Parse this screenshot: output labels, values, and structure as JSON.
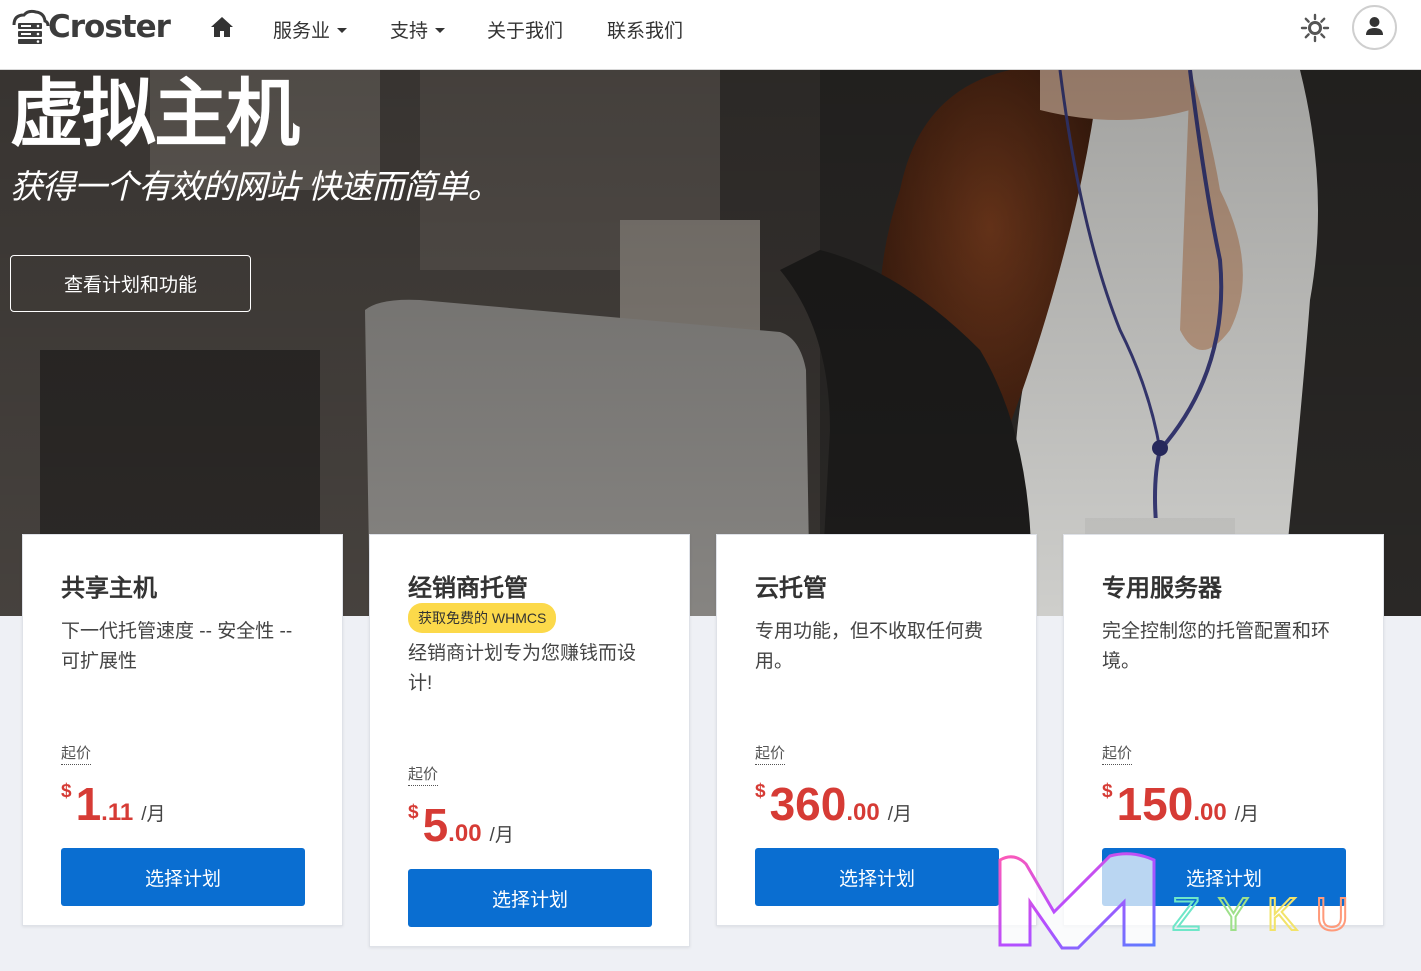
{
  "nav": {
    "brand": "Croster",
    "menu": [
      {
        "label": "服务业",
        "dropdown": true
      },
      {
        "label": "支持",
        "dropdown": true
      },
      {
        "label": "关于我们",
        "dropdown": false
      },
      {
        "label": "联系我们",
        "dropdown": false
      }
    ],
    "icons": [
      "server-logo-icon",
      "home-icon",
      "sun-icon",
      "user-icon",
      "caret-down-icon"
    ]
  },
  "hero": {
    "title": "虚拟主机",
    "subtitle": "获得一个有效的网站 快速而简单。",
    "button": "查看计划和功能"
  },
  "cards": [
    {
      "title": "共享主机",
      "badge": "",
      "description": "下一代托管速度 -- 安全性 -- 可扩展性",
      "from": "起价",
      "currency": "$",
      "integer": "1",
      "decimal": ".11",
      "period": "/月",
      "button": "选择计划"
    },
    {
      "title": "经销商托管",
      "badge": "获取免费的 WHMCS",
      "description": "经销商计划专为您赚钱而设计!",
      "from": "起价",
      "currency": "$",
      "integer": "5",
      "decimal": ".00",
      "period": "/月",
      "button": "选择计划"
    },
    {
      "title": "云托管",
      "badge": "",
      "description": "专用功能，但不收取任何费用。",
      "from": "起价",
      "currency": "$",
      "integer": "360",
      "decimal": ".00",
      "period": "/月",
      "button": "选择计划"
    },
    {
      "title": "专用服务器",
      "badge": "",
      "description": "完全控制您的托管配置和环境。",
      "from": "起价",
      "currency": "$",
      "integer": "150",
      "decimal": ".00",
      "period": "/月",
      "button": "选择计划"
    }
  ],
  "watermark": {
    "letter": "M",
    "text": "ZYKU"
  },
  "colors": {
    "accent": "#0a6ed1",
    "price": "#d63b35",
    "badge": "#fcd94a",
    "page_bg": "#eef0f5"
  }
}
